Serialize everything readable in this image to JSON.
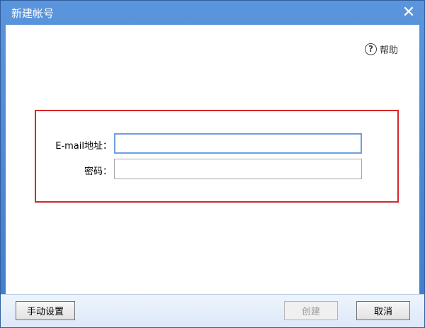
{
  "window": {
    "title": "新建帐号",
    "close_glyph": "✕"
  },
  "help": {
    "icon_glyph": "?",
    "label": "帮助"
  },
  "form": {
    "email_label": "E-mail地址：",
    "email_value": "",
    "password_label": "密码：",
    "password_value": ""
  },
  "buttons": {
    "manual_setup": "手动设置",
    "create": "创建",
    "cancel": "取消"
  },
  "colors": {
    "title_bar": "#4a86d4",
    "highlight_border": "#d7262a",
    "focused_input_border": "#6d9fe0"
  }
}
